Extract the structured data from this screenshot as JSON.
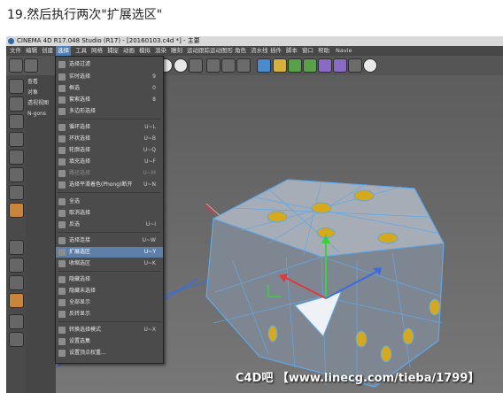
{
  "caption": "19.然后执行两次\"扩展选区\"",
  "window": {
    "title": "CINEMA 4D R17.048 Studio (R17) - [20160103.c4d *] - 主要"
  },
  "menubar": {
    "items": [
      "文件",
      "编辑",
      "创建",
      "选择",
      "工具",
      "网格",
      "捕捉",
      "动画",
      "模拟",
      "渲染",
      "雕刻",
      "运动跟踪",
      "运动图形",
      "角色",
      "流水线",
      "插件",
      "脚本",
      "窗口",
      "帮助"
    ],
    "extra": "Navie"
  },
  "panel": {
    "labels": [
      "查看",
      "对象",
      "透视视图",
      "N-gons"
    ]
  },
  "select_menu": {
    "items": [
      {
        "label": "选择过滤",
        "shortcut": "",
        "disabled": false
      },
      {
        "label": "实时选择",
        "shortcut": "9",
        "disabled": false
      },
      {
        "label": "框选",
        "shortcut": "0",
        "disabled": false
      },
      {
        "label": "套索选择",
        "shortcut": "8",
        "disabled": false
      },
      {
        "label": "多边形选择",
        "shortcut": "",
        "disabled": false
      },
      {
        "label": "循环选择",
        "shortcut": "U~L",
        "disabled": false
      },
      {
        "label": "环状选择",
        "shortcut": "U~B",
        "disabled": false
      },
      {
        "label": "轮廓选择",
        "shortcut": "U~Q",
        "disabled": false
      },
      {
        "label": "填充选择",
        "shortcut": "U~F",
        "disabled": false
      },
      {
        "label": "路径选择",
        "shortcut": "U~M",
        "disabled": true
      },
      {
        "label": "选择平滑着色(Phong)断开",
        "shortcut": "U~N",
        "disabled": false
      },
      {
        "label": "全选",
        "shortcut": "",
        "disabled": false
      },
      {
        "label": "取消选择",
        "shortcut": "",
        "disabled": false
      },
      {
        "label": "反选",
        "shortcut": "U~I",
        "disabled": false
      },
      {
        "label": "选择连接",
        "shortcut": "U~W",
        "disabled": false
      },
      {
        "label": "扩展选区",
        "shortcut": "U~Y",
        "disabled": false,
        "highlighted": true
      },
      {
        "label": "收缩选区",
        "shortcut": "U~K",
        "disabled": false
      },
      {
        "label": "隐藏选择",
        "shortcut": "",
        "disabled": false
      },
      {
        "label": "隐藏未选择",
        "shortcut": "",
        "disabled": false
      },
      {
        "label": "全部显示",
        "shortcut": "",
        "disabled": false
      },
      {
        "label": "反转显示",
        "shortcut": "",
        "disabled": false
      },
      {
        "label": "转换选择模式",
        "shortcut": "U~X",
        "disabled": false
      },
      {
        "label": "设置选集",
        "shortcut": "",
        "disabled": false
      },
      {
        "label": "设置顶点权重...",
        "shortcut": "",
        "disabled": false
      }
    ]
  },
  "watermark": "C4D吧 【www.linecg.com/tieba/1799】",
  "colors": {
    "highlight": "#5d7fa8",
    "mesh_line": "#5fa8e8",
    "hole_fill": "#d6a91c",
    "axis_green": "#39d23a",
    "axis_red": "#e03a3a",
    "axis_blue": "#3a6de0"
  }
}
